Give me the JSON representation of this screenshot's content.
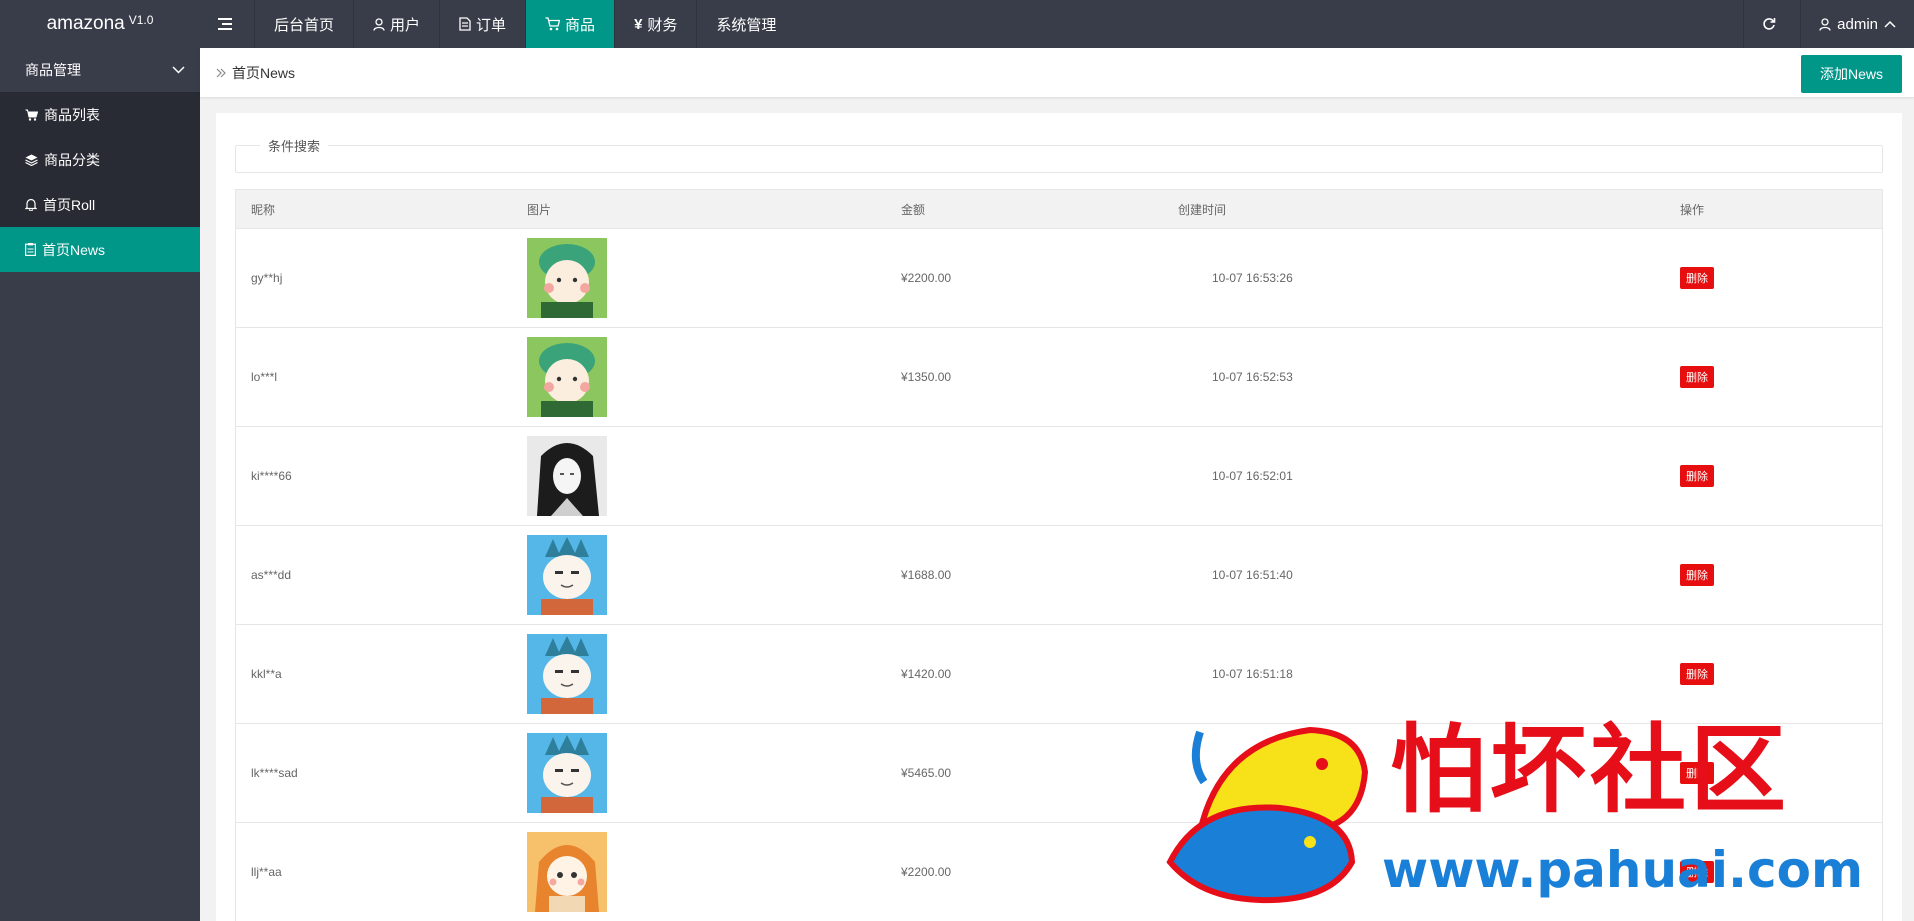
{
  "app": {
    "name": "amazona",
    "version": "V1.0"
  },
  "topnav": {
    "items": [
      {
        "label": "后台首页",
        "icon": "none"
      },
      {
        "label": "用户",
        "icon": "user-icon"
      },
      {
        "label": "订单",
        "icon": "document-icon"
      },
      {
        "label": "商品",
        "icon": "cart-icon",
        "active": true
      },
      {
        "label": "财务",
        "icon": "yen-icon"
      },
      {
        "label": "系统管理",
        "icon": "none"
      }
    ],
    "user": "admin"
  },
  "sidebar": {
    "group": "商品管理",
    "items": [
      {
        "label": "商品列表",
        "icon": "cart-icon"
      },
      {
        "label": "商品分类",
        "icon": "layers-icon"
      },
      {
        "label": "首页Roll",
        "icon": "bell-icon"
      },
      {
        "label": "首页News",
        "icon": "note-icon",
        "active": true
      }
    ]
  },
  "breadcrumb": {
    "current": "首页News"
  },
  "toolbar": {
    "add_label": "添加News"
  },
  "search": {
    "legend": "条件搜索"
  },
  "table": {
    "headers": [
      "昵称",
      "图片",
      "金额",
      "创建时间",
      "操作"
    ],
    "rows": [
      {
        "name": "gy**hj",
        "avatar": "green-hair-cat",
        "amount": "¥2200.00",
        "time": "10-07 16:53:26",
        "action": "删除"
      },
      {
        "name": "lo***l",
        "avatar": "green-hair-cat",
        "amount": "¥1350.00",
        "time": "10-07 16:52:53",
        "action": "删除"
      },
      {
        "name": "ki****66",
        "avatar": "black-hair-sketch",
        "amount": "",
        "time": "10-07 16:52:01",
        "action": "删除"
      },
      {
        "name": "as***dd",
        "avatar": "blue-hair-cat",
        "amount": "¥1688.00",
        "time": "10-07 16:51:40",
        "action": "删除"
      },
      {
        "name": "kkl**a",
        "avatar": "blue-hair-cat",
        "amount": "¥1420.00",
        "time": "10-07 16:51:18",
        "action": "删除"
      },
      {
        "name": "lk****sad",
        "avatar": "blue-hair-cat",
        "amount": "¥5465.00",
        "time": "",
        "action": "删除"
      },
      {
        "name": "llj**aa",
        "avatar": "orange-hair-girl",
        "amount": "¥2200.00",
        "time": ":04",
        "action": "删除"
      }
    ]
  },
  "watermark": {
    "title": "怕坏社区",
    "url": "www.pahuai.com"
  },
  "colors": {
    "topbar": "#393d49",
    "accent": "#009688",
    "danger": "#e60e0e",
    "submenu": "#282b33"
  }
}
